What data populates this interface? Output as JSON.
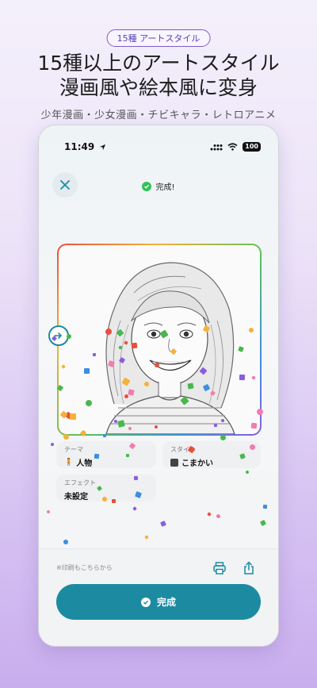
{
  "badge": "15種 アートスタイル",
  "headline": {
    "line1": "15種以上のアートスタイル",
    "line2": "漫画風や絵本風に変身"
  },
  "subline": "少年漫画・少女漫画・チビキャラ・レトロアニメ",
  "phone": {
    "status_bar": {
      "time": "11:49",
      "battery": "100"
    },
    "header": {
      "close_icon": "close-icon",
      "status_text": "完成!"
    },
    "portrait": {
      "description_icon": "sketch-portrait"
    },
    "cards": {
      "theme": {
        "label": "テーマ",
        "value": "人物"
      },
      "style": {
        "label": "スタイル",
        "value": "こまかい"
      },
      "effect": {
        "label": "エフェクト",
        "value": "未設定"
      }
    },
    "bottom": {
      "print_hint": "※印刷もこちらから",
      "complete_label": "完成"
    }
  },
  "colors": {
    "accent": "#1c8ba2",
    "badge_border": "#7a5bd0",
    "success": "#34c25a"
  }
}
